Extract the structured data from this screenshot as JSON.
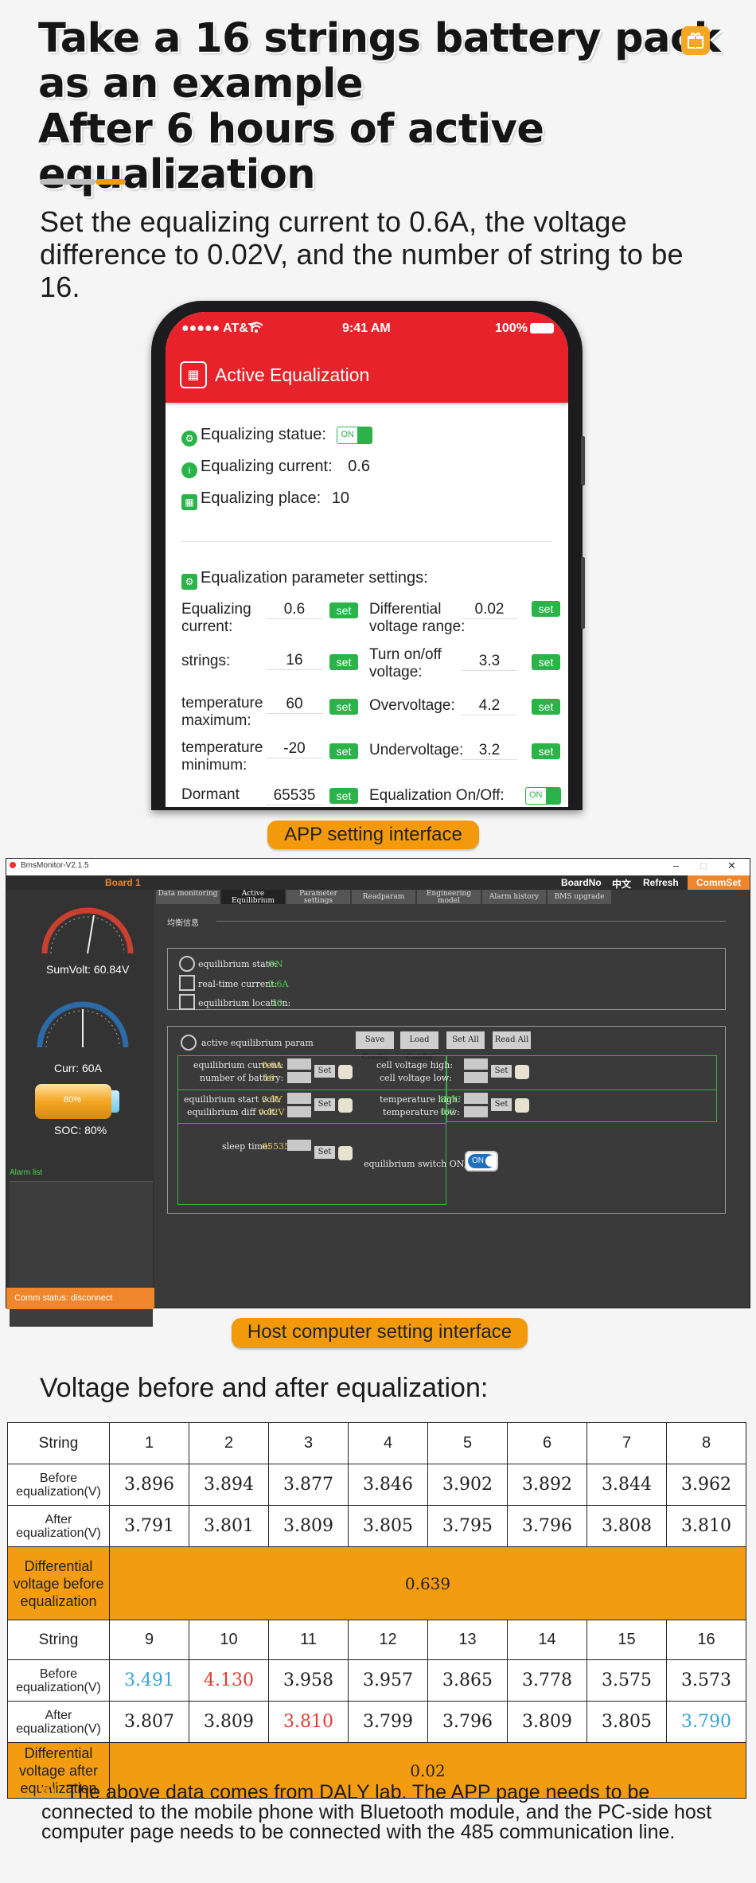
{
  "headline": {
    "line1": "Take a 16 strings battery pack",
    "line2": "as an example",
    "line3": "After 6 hours of active equalization"
  },
  "intro": "Set the equalizing current to 0.6A, the voltage difference to 0.02V, and the number of string to be 16.",
  "app": {
    "status": {
      "carrier": "●●●●● AT&T",
      "time": "9:41 AM",
      "battery": "100%"
    },
    "title": "Active Equalization",
    "status_rows": [
      {
        "label": "Equalizing statue:",
        "value": "ON"
      },
      {
        "label": "Equalizing current:",
        "value": "0.6"
      },
      {
        "label": "Equalizing place:",
        "value": "10"
      }
    ],
    "params_title": "Equalization parameter settings:",
    "set_label": "set",
    "params_left": [
      {
        "label": "Equalizing current:",
        "value": "0.6"
      },
      {
        "label": "strings:",
        "value": "16"
      },
      {
        "label": "temperature maximum:",
        "value": "60"
      },
      {
        "label": "temperature minimum:",
        "value": "-20"
      },
      {
        "label": "Dormant",
        "value": "65535"
      }
    ],
    "params_right": [
      {
        "label": "Differential voltage range:",
        "value": "0.02"
      },
      {
        "label": "Turn on/off voltage:",
        "value": "3.3"
      },
      {
        "label": "Overvoltage:",
        "value": "4.2"
      },
      {
        "label": "Undervoltage:",
        "value": "3.2"
      },
      {
        "label": "Equalization On/Off:",
        "value": "ON"
      }
    ],
    "caption": "APP setting interface"
  },
  "host": {
    "title": "BmsMonitor-V2.1.5",
    "board": "Board 1",
    "menu": [
      "BoardNo",
      "中文",
      "Refresh",
      "CommSet"
    ],
    "tabs": [
      "Data monitoring",
      "Active Equilibrium",
      "Parameter settings",
      "Readparam",
      "Engineering model",
      "Alarm history",
      "BMS upgrade"
    ],
    "section": "均衡信息",
    "sumvolt": "SumVolt: 60.84V",
    "curr": "Curr: 60A",
    "soc_pct": "80%",
    "soc": "SOC: 80%",
    "alarm_list": "Alarm list",
    "comm_status": "Comm status: disconnect",
    "state_rows": [
      {
        "label": "equilibrium state:",
        "value": "ON"
      },
      {
        "label": "real-time current:",
        "value": "0.6A"
      },
      {
        "label": "equilibrium location:",
        "value": "10"
      }
    ],
    "param_title": "active equilibrium param",
    "buttons": [
      "Save Config",
      "Load Config",
      "Set All",
      "Read All"
    ],
    "set_label": "Set",
    "eq_current": {
      "label": "equilibrium current:",
      "value": "0.6A"
    },
    "num_battery": {
      "label": "number of battery:",
      "value": "16"
    },
    "start_volt": {
      "label": "equilibrium start volt:",
      "value": "3.5V"
    },
    "diff_volt": {
      "label": "equilibrium diff volt:",
      "value": "0.02V"
    },
    "sleep_time": {
      "label": "sleep time:",
      "value": "65535s"
    },
    "cell_high": "cell voltage high:",
    "cell_low": "cell voltage low:",
    "temp_high": {
      "label": "temperature high:",
      "value": "80℃"
    },
    "temp_low": {
      "label": "temperature low:",
      "value": "0℃"
    },
    "switch": {
      "label": "equilibrium switch ON/OFF:",
      "value": "ON"
    },
    "caption": "Host computer setting interface",
    "colors": {
      "value_green": "#4cd44f",
      "value_yellow": "#e8c94b",
      "accent": "#f0862b"
    }
  },
  "table": {
    "title": "Voltage before and after equalization:",
    "string_label": "String",
    "before_label": "Before equalization(V)",
    "after_label": "After equalization(V)",
    "diff_before_label": "Differential voltage before equalization",
    "diff_after_label": "Differential voltage after equalization",
    "strings_1": [
      "1",
      "2",
      "3",
      "4",
      "5",
      "6",
      "7",
      "8"
    ],
    "before_1": [
      "3.896",
      "3.894",
      "3.877",
      "3.846",
      "3.902",
      "3.892",
      "3.844",
      "3.962"
    ],
    "after_1": [
      "3.791",
      "3.801",
      "3.809",
      "3.805",
      "3.795",
      "3.796",
      "3.808",
      "3.810"
    ],
    "diff_before": "0.639",
    "strings_2": [
      "9",
      "10",
      "11",
      "12",
      "13",
      "14",
      "15",
      "16"
    ],
    "before_2": [
      "3.491",
      "4.130",
      "3.958",
      "3.957",
      "3.865",
      "3.778",
      "3.575",
      "3.573"
    ],
    "after_2": [
      "3.807",
      "3.809",
      "3.810",
      "3.799",
      "3.796",
      "3.809",
      "3.805",
      "3.790"
    ],
    "diff_after": "0.02",
    "colors": {
      "highlight_min": "#3aa3d8",
      "highlight_max": "#e03b31",
      "band": "#f39c12"
    }
  },
  "note": "The above data comes from DALY lab. The APP page needs to be connected to the mobile phone with  Bluetooth module, and the PC-side host computer page needs to be connected with the 485 communication line."
}
